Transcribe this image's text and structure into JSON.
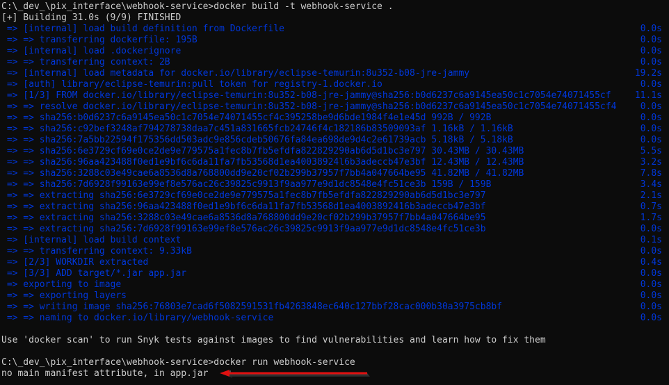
{
  "terminal": {
    "lines": [
      {
        "text": "C:\\_dev_\\pix_interface\\webhook-service>docker build -t webhook-service .",
        "kind": "command",
        "time": ""
      },
      {
        "text": "[+] Building 31.0s (9/9) FINISHED",
        "kind": "status",
        "time": ""
      },
      {
        "text": " => [internal] load build definition from Dockerfile",
        "kind": "step",
        "time": "0.0s"
      },
      {
        "text": " => => transferring dockerfile: 195B",
        "kind": "step",
        "time": "0.0s"
      },
      {
        "text": " => [internal] load .dockerignore",
        "kind": "step",
        "time": "0.0s"
      },
      {
        "text": " => => transferring context: 2B",
        "kind": "step",
        "time": "0.0s"
      },
      {
        "text": " => [internal] load metadata for docker.io/library/eclipse-temurin:8u352-b08-jre-jammy",
        "kind": "step",
        "time": "19.2s"
      },
      {
        "text": " => [auth] library/eclipse-temurin:pull token for registry-1.docker.io",
        "kind": "step",
        "time": "0.0s"
      },
      {
        "text": " => [1/3] FROM docker.io/library/eclipse-temurin:8u352-b08-jre-jammy@sha256:b0d6237c6a9145ea50c1c7054e74071455cf",
        "kind": "step",
        "time": "11.1s"
      },
      {
        "text": " => => resolve docker.io/library/eclipse-temurin:8u352-b08-jre-jammy@sha256:b0d6237c6a9145ea50c1c7054e74071455cf4",
        "kind": "step",
        "time": "0.0s"
      },
      {
        "text": " => => sha256:b0d6237c6a9145ea50c1c7054e74071455cf4c395258be9d6bde1984f4e1e45d 992B / 992B",
        "kind": "step",
        "time": "0.0s"
      },
      {
        "text": " => => sha256:c92bef3248af794278738daa7c451a831665fcb24746f4c182186b83509093af 1.16kB / 1.16kB",
        "kind": "step",
        "time": "0.0s"
      },
      {
        "text": " => => sha256:7a5bb22594f175356dd503adc9e856cdeb50676fa84ea698de9d4c2e61739acb 5.18kB / 5.18kB",
        "kind": "step",
        "time": "0.0s"
      },
      {
        "text": " => => sha256:6e3729cf69e0ce2de9e779575a1fec8b7fb5efdfa822829290ab6d5d1bc3e797 30.43MB / 30.43MB",
        "kind": "step",
        "time": "5.5s"
      },
      {
        "text": " => => sha256:96aa423488f0ed1e9bf6c6da11fa7fb53568d1ea40038924l6b3adeccb47e3bf 12.43MB / 12.43MB",
        "kind": "step",
        "time": "3.2s"
      },
      {
        "text": " => => sha256:3288c03e49cae6a8536d8a768800dd9e20cf02b299b37957f7bb4a047664be95 41.82MB / 41.82MB",
        "kind": "step",
        "time": "7.8s"
      },
      {
        "text": " => => sha256:7d6928f99163e99ef8e576ac26c39825c9913f9aa977e9d1dc8548e4fc51ce3b 159B / 159B",
        "kind": "step",
        "time": "3.4s"
      },
      {
        "text": " => => extracting sha256:6e3729cf69e0ce2de9e779575a1fec8b7fb5efdfa822829290ab6d5d1bc3e797",
        "kind": "step",
        "time": "2.1s"
      },
      {
        "text": " => => extracting sha256:96aa423488f0ed1e9bf6c6da11fa7fb53568d1ea4003892416b3adeccb47e3bf",
        "kind": "step",
        "time": "0.7s"
      },
      {
        "text": " => => extracting sha256:3288c03e49cae6a8536d8a768800dd9e20cf02b299b37957f7bb4a047664be95",
        "kind": "step",
        "time": "1.7s"
      },
      {
        "text": " => => extracting sha256:7d6928f99163e99ef8e576ac26c39825c9913f9aa977e9d1dc8548e4fc51ce3b",
        "kind": "step",
        "time": "0.0s"
      },
      {
        "text": " => [internal] load build context",
        "kind": "step",
        "time": "0.1s"
      },
      {
        "text": " => => transferring context: 9.33kB",
        "kind": "step",
        "time": "0.0s"
      },
      {
        "text": " => [2/3] WORKDIR extracted",
        "kind": "step",
        "time": "0.4s"
      },
      {
        "text": " => [3/3] ADD target/*.jar app.jar",
        "kind": "step",
        "time": "0.0s"
      },
      {
        "text": " => exporting to image",
        "kind": "step",
        "time": "0.0s"
      },
      {
        "text": " => => exporting layers",
        "kind": "step",
        "time": "0.0s"
      },
      {
        "text": " => => writing image sha256:76803e7cad6f5082591531fb4263848ec640c127bbf28cac000b30a3975cb8bf",
        "kind": "step",
        "time": "0.0s"
      },
      {
        "text": " => => naming to docker.io/library/webhook-service",
        "kind": "step",
        "time": "0.0s"
      },
      {
        "text": "",
        "kind": "blank",
        "time": ""
      },
      {
        "text": "Use 'docker scan' to run Snyk tests against images to find vulnerabilities and learn how to fix them",
        "kind": "info",
        "time": ""
      },
      {
        "text": "",
        "kind": "blank",
        "time": ""
      },
      {
        "text": "C:\\_dev_\\pix_interface\\webhook-service>docker run webhook-service",
        "kind": "command",
        "time": ""
      },
      {
        "text": "no main manifest attribute, in app.jar",
        "kind": "error",
        "time": ""
      }
    ]
  },
  "annotation": {
    "arrow_icon": "red-arrow-left",
    "color": "#e01010"
  },
  "colors": {
    "background": "#0c0c0c",
    "text": "#cccccc",
    "step_blue": "#0037da"
  }
}
